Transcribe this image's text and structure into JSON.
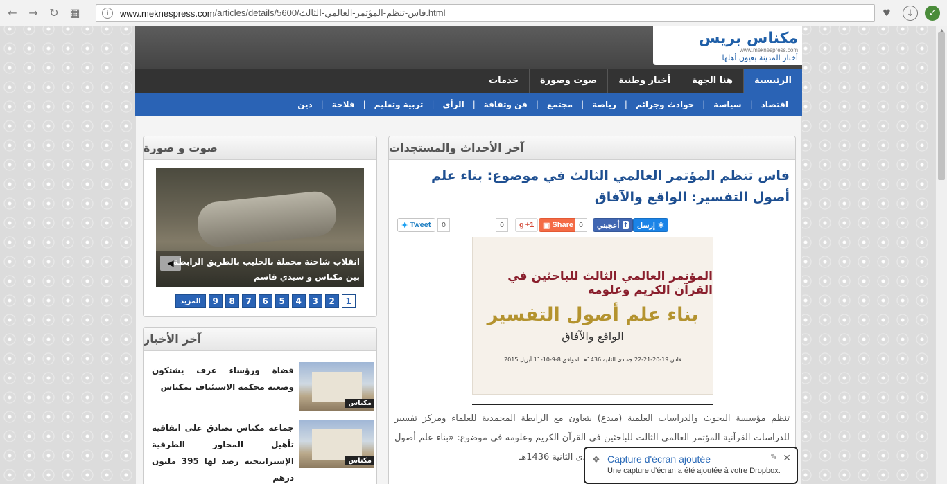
{
  "browser": {
    "url_host": "www.meknespress.com",
    "url_path": "/articles/details/5600/فاس-تنظم-المؤتمر-العالمي-الثالث.html"
  },
  "site": {
    "logo_word": "مكناس بريس",
    "logo_tagline": "أخبار المدينة بعيون أهلها",
    "logo_url": "www.meknespress.com",
    "main_nav": [
      "الرئيسية",
      "هنا الجهة",
      "أخبار وطنية",
      "صوت وصورة",
      "خدمات"
    ],
    "sub_nav": [
      "اقتصاد",
      "سياسة",
      "حوادث وجرائم",
      "رياضة",
      "مجتمع",
      "فن وثقافة",
      "الرأي",
      "تربية وتعليم",
      "فلاحة",
      "دين"
    ]
  },
  "article_panel": {
    "header": "آخر الأحداث والمستجدات",
    "title": "فاس تنظم المؤتمر العالمي الثالث في موضوع: بناء علم أصول التفسير: الواقع والآفاق",
    "share": {
      "messenger": "إرسل",
      "facebook": "أعجبني",
      "facebook_count": "0",
      "share": "Share",
      "gplus": "+1",
      "gplus_count": "0",
      "tweet": "Tweet",
      "tweet_count": "0"
    },
    "poster": {
      "line1": "المؤتمر العالمي الثالث للباحثين في القرآن الكريم وعلومه",
      "line2": "بناء علم أصول التفسير",
      "line3": "الواقع والآفاق",
      "line4": "فاس 19-20-21-22 جمادى الثانية 1436هـ الموافق 8-9-10-11 أبريل 2015"
    },
    "body": "تنظم مؤسسة البحوث والدراسات العلمية (مبدع) بتعاون مع الرابطة المحمدية للعلماء ومركز تفسير للدراسات القرآنية المؤتمر العالمي الثالث للباحثين في القرآن الكريم وعلومه في موضوع: «بناء علم أصول التفسير: الواقع والآفاق» وذلك أيام 19-20-21-22 جمادى الثانية 1436هـ"
  },
  "video_panel": {
    "header": "صوت و صورة",
    "caption": "انقلاب شاحنة محملة بالحليب بالطريق الرابطة بين مكناس و سيدي قاسم",
    "pages": [
      "1",
      "2",
      "3",
      "4",
      "5",
      "6",
      "7",
      "8",
      "9"
    ],
    "more": "المزيد"
  },
  "news_panel": {
    "header": "آخر الأخبار",
    "items": [
      {
        "text": "قضاة ورؤساء غرف يشتكون وضعية محكمة الاستئناف بمكناس",
        "tag": "مكناس"
      },
      {
        "text": "جماعة مكناس تصادق على اتفاقية تأهيل المحاور الطرقية الإستراتيجية رصد لها 395 مليون درهم",
        "tag": "مكناس"
      }
    ]
  },
  "toast": {
    "title": "Capture d'écran ajoutée",
    "body": "Une capture d'écran a été ajoutée à votre Dropbox."
  },
  "colors": {
    "brand_blue": "#2a63b5",
    "title_blue": "#1e4f91",
    "nav_dark": "#333333"
  }
}
